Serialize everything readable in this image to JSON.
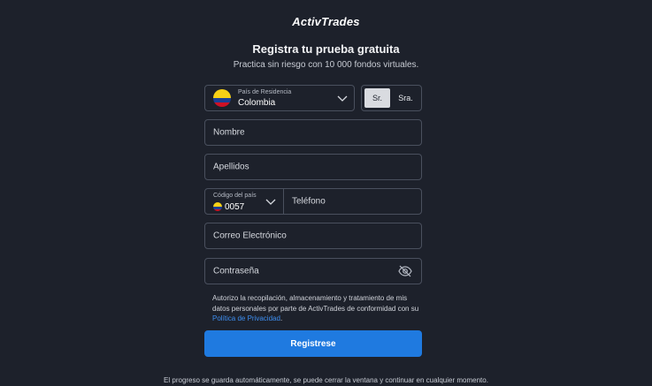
{
  "brand": {
    "logo_text": "ActivTrades"
  },
  "form": {
    "title": "Registra tu prueba gratuita",
    "subtitle": "Practica sin riesgo con 10 000 fondos virtuales.",
    "country": {
      "label": "País de Residencia",
      "value": "Colombia"
    },
    "salutation": {
      "options": [
        "Sr.",
        "Sra."
      ],
      "selected": "Sr."
    },
    "first_name": {
      "placeholder": "Nombre"
    },
    "last_name": {
      "placeholder": "Apellidos"
    },
    "phone": {
      "code_label": "Código del país",
      "code_value": "0057",
      "placeholder": "Teléfono"
    },
    "email": {
      "placeholder": "Correo Electrónico"
    },
    "password": {
      "placeholder": "Contraseña"
    },
    "consent": {
      "text": "Autorizo la recopilación, almacenamiento y tratamiento de mis datos personales por parte de ActivTrades de conformidad con su ",
      "link": "Política de Privacidad",
      "end": "."
    },
    "submit_label": "Registrese",
    "footer": "El progreso se guarda automáticamente, se puede cerrar la ventana y continuar en cualquier momento."
  },
  "colors": {
    "background": "#1d212b",
    "accent": "#1f7ae0",
    "border": "#4a505e",
    "link": "#3d8ef0"
  },
  "icons": {
    "flag": "colombia-flag-icon",
    "dropdown": "chevron-down-icon",
    "password_toggle": "eye-off-icon"
  }
}
